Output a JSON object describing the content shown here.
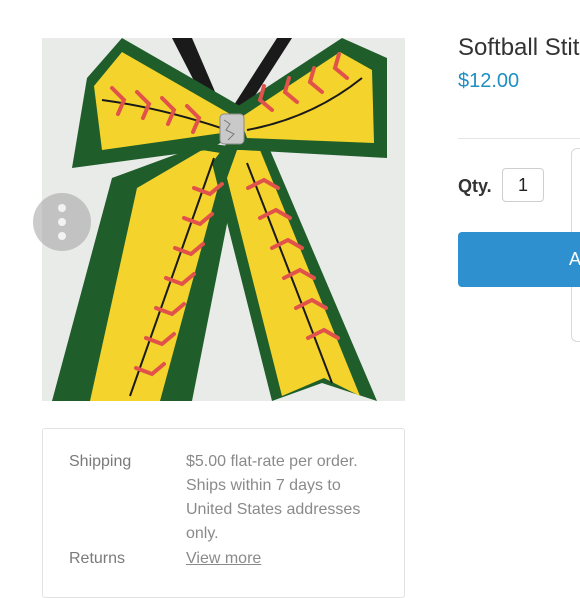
{
  "product": {
    "title": "Softball Stit",
    "price": "$12.00",
    "image_icon": "softball-stitch-hair-bow",
    "colors": {
      "ribbon_green": "#1f5d2b",
      "ribbon_yellow": "#f4d32c",
      "stitch_red": "#e0524a",
      "price_blue": "#1f8fc4",
      "button_blue": "#2e90cf"
    }
  },
  "menu_button": {
    "icon": "more-vertical-icon"
  },
  "purchase": {
    "qty_label": "Qty.",
    "qty_value": "1",
    "add_button_label": "A"
  },
  "info": {
    "shipping_label": "Shipping",
    "shipping_value": "$5.00 flat-rate per order. Ships within 7 days to United States addresses only.",
    "returns_label": "Returns",
    "returns_link": "View more"
  }
}
